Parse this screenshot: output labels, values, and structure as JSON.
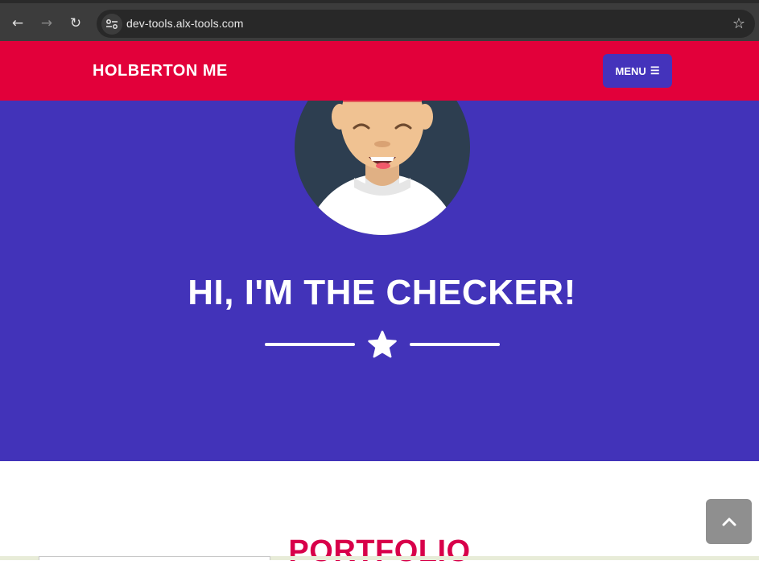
{
  "browser": {
    "url": "dev-tools.alx-tools.com",
    "back_icon": "←",
    "forward_icon": "→",
    "reload_icon": "↻",
    "star_icon": "☆"
  },
  "nav": {
    "brand": "HOLBERTON ME",
    "menu_label": "MENU",
    "menu_icon": "☰"
  },
  "hero": {
    "title": "HI, I'M THE CHECKER!"
  },
  "portfolio": {
    "title": "PORTFOLIO"
  },
  "colors": {
    "nav_bg": "#e2003a",
    "hero_bg": "#4233b9",
    "menu_bg": "#4433bb",
    "portfolio_title": "#d8004a",
    "scroll_top_bg": "#8f8f8f"
  }
}
